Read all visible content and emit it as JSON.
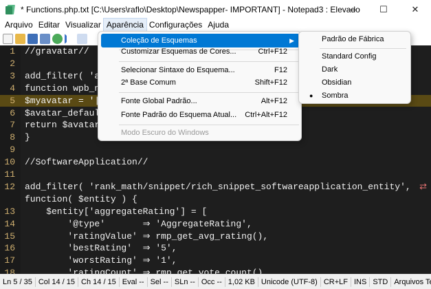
{
  "window": {
    "title": "* Functions.php.txt [C:\\Users\\raflo\\Desktop\\Newspapper- IMPORTANT] - Notepad3 : Elevado",
    "minimize": "—",
    "maximize": "☐",
    "close": "✕"
  },
  "menubar": {
    "items": [
      "Arquivo",
      "Editar",
      "Visualizar",
      "Aparência",
      "Configurações",
      "Ajuda"
    ]
  },
  "editor": {
    "lines": [
      {
        "n": "1",
        "text": "//gravatar//"
      },
      {
        "n": "2",
        "text": ""
      },
      {
        "n": "3",
        "text": "add_filter( 'av"
      },
      {
        "n": "4",
        "text": "function wpb_ne"
      },
      {
        "n": "5",
        "text": "$myavatar = '|'"
      },
      {
        "n": "6",
        "text": "$avatar_default"
      },
      {
        "n": "7",
        "text": "return $avatar_"
      },
      {
        "n": "8",
        "text": "}"
      },
      {
        "n": "9",
        "text": ""
      },
      {
        "n": "10",
        "text": "//SoftwareApplication//"
      },
      {
        "n": "11",
        "text": ""
      },
      {
        "n": "12",
        "text": "add_filter( 'rank_math/snippet/rich_snippet_softwareapplication_entity',"
      },
      {
        "n": "",
        "text": "function( $entity ) {"
      },
      {
        "n": "13",
        "text": "    $entity['aggregateRating'] = ["
      },
      {
        "n": "14",
        "text": "        '@type'       ⇒ 'AggregateRating',"
      },
      {
        "n": "15",
        "text": "        'ratingValue' ⇒ rmp_get_avg_rating(),"
      },
      {
        "n": "16",
        "text": "        'bestRating'  ⇒ '5',"
      },
      {
        "n": "17",
        "text": "        'worstRating' ⇒ '1',"
      },
      {
        "n": "18",
        "text": "        'ratingCount' ⇒ rmp_get_vote_count(),"
      }
    ],
    "current_line": "5",
    "wrap_icon": "⇄"
  },
  "appearance_menu": {
    "items": [
      {
        "label": "Coleção de Esquemas",
        "shortcut": "",
        "has_submenu": true,
        "highlighted": true
      },
      {
        "label": "Customizar Esquemas de Cores...",
        "shortcut": "Ctrl+F12"
      },
      {
        "label": "Selecionar Sintaxe do Esquema...",
        "shortcut": "F12"
      },
      {
        "label": "2ª Base Comum",
        "shortcut": "Shift+F12"
      },
      {
        "label": "Fonte Global Padrão...",
        "shortcut": "Alt+F12"
      },
      {
        "label": "Fonte Padrão do Esquema Atual...",
        "shortcut": "Ctrl+Alt+F12"
      },
      {
        "label": "Modo Escuro do Windows",
        "shortcut": "",
        "disabled": true
      }
    ]
  },
  "schemes_submenu": {
    "items": [
      {
        "label": "Padrão de Fábrica"
      },
      {
        "label": "Standard Config"
      },
      {
        "label": "Dark"
      },
      {
        "label": "Obsidian"
      },
      {
        "label": "Sombra",
        "selected": true
      }
    ],
    "bullet": "●"
  },
  "statusbar": {
    "items": [
      "Ln 5 / 35",
      "Col 14 / 15",
      "Ch 14 / 15",
      "Eval --",
      "Sel --",
      "SLn --",
      "Occ --",
      "1,02 KB",
      "Unicode (UTF-8)",
      "CR+LF",
      "INS",
      "STD",
      "Arquivos Texto"
    ]
  },
  "colors": {
    "accent": "#0078d4",
    "editor_bg": "#1e1e1e",
    "current_line": "#5a4a14",
    "line_numbers": "#d0b070"
  }
}
